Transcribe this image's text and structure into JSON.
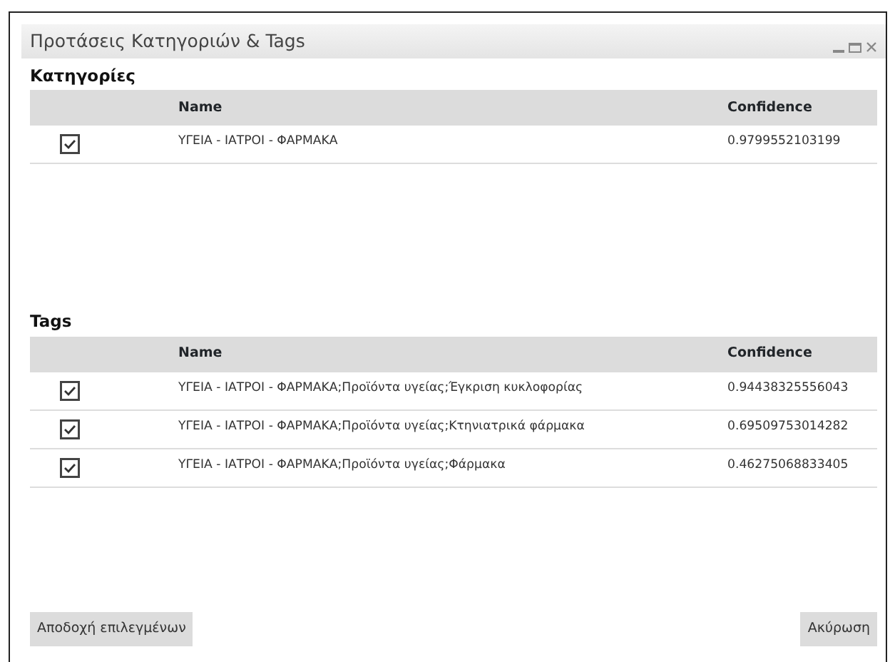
{
  "window": {
    "title": "Προτάσεις Κατηγοριών & Tags"
  },
  "sections": [
    {
      "title": "Κατηγορίες",
      "columns": [
        "Name",
        "Confidence"
      ],
      "rows": [
        {
          "checked": true,
          "name": "ΥΓΕΙΑ - ΙΑΤΡΟΙ - ΦΑΡΜΑΚΑ",
          "confidence": "0.9799552103199"
        }
      ]
    },
    {
      "title": "Tags",
      "columns": [
        "Name",
        "Confidence"
      ],
      "rows": [
        {
          "checked": true,
          "name": "ΥΓΕΙΑ - ΙΑΤΡΟΙ - ΦΑΡΜΑΚΑ;Προϊόντα υγείας;Έγκριση κυκλοφορίας",
          "confidence": "0.94438325556043"
        },
        {
          "checked": true,
          "name": "ΥΓΕΙΑ - ΙΑΤΡΟΙ - ΦΑΡΜΑΚΑ;Προϊόντα υγείας;Κτηνιατρικά φάρμακα",
          "confidence": "0.69509753014282"
        },
        {
          "checked": true,
          "name": "ΥΓΕΙΑ - ΙΑΤΡΟΙ - ΦΑΡΜΑΚΑ;Προϊόντα υγείας;Φάρμακα",
          "confidence": "0.46275068833405"
        }
      ]
    }
  ],
  "buttons": [
    "Αποδοχή επιλεγμένων",
    "Ακύρωση"
  ]
}
